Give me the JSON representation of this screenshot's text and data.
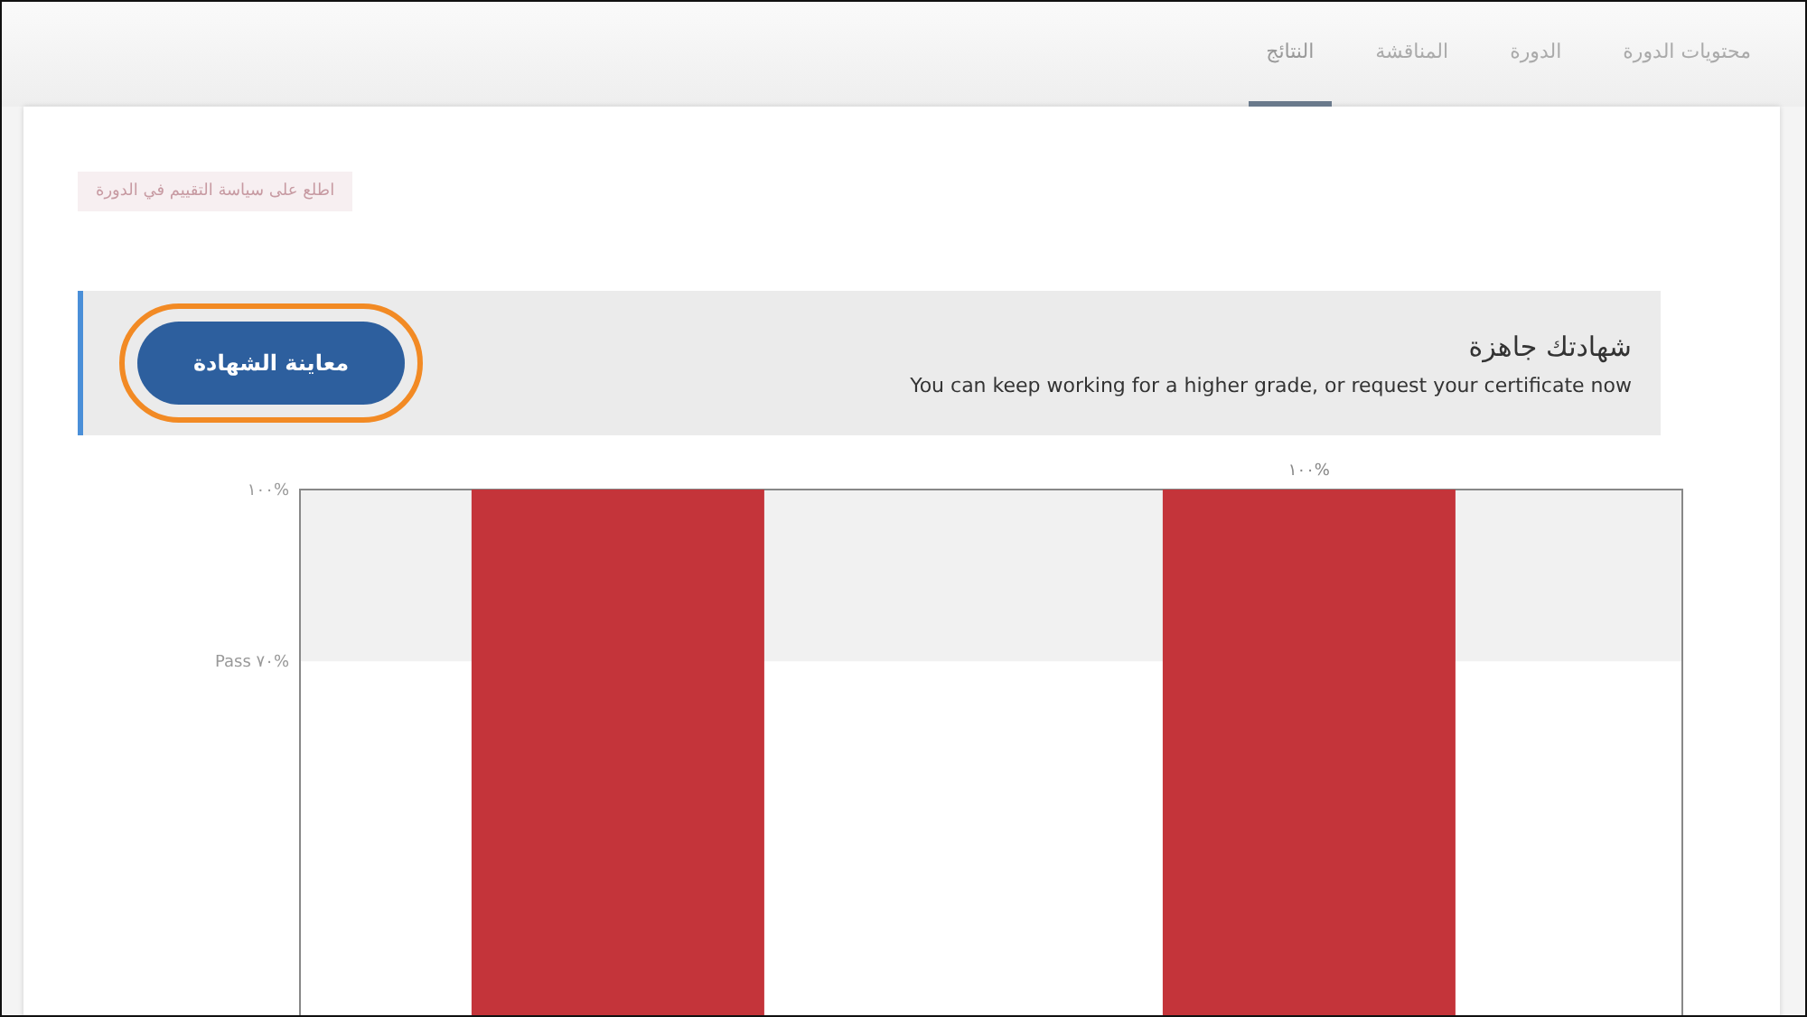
{
  "tabs": [
    {
      "label": "محتويات الدورة",
      "selected": false
    },
    {
      "label": "الدورة",
      "selected": false
    },
    {
      "label": "المناقشة",
      "selected": false
    },
    {
      "label": "النتائج",
      "selected": true
    }
  ],
  "policy_link": "اطلع على سياسة التقييم في الدورة",
  "certificate_banner": {
    "title": "شهادتك جاهزة",
    "message": "You can keep working for a higher grade, or request your certificate now",
    "button": "معاينة الشهادة",
    "highlighted": true
  },
  "grade_chart": {
    "axis_labels": [
      "١٠٠%",
      "Pass ٧٠%"
    ],
    "bars": [
      {
        "kind": "plain"
      },
      {
        "kind": "labelled",
        "label": "١٠٠%"
      }
    ]
  }
}
